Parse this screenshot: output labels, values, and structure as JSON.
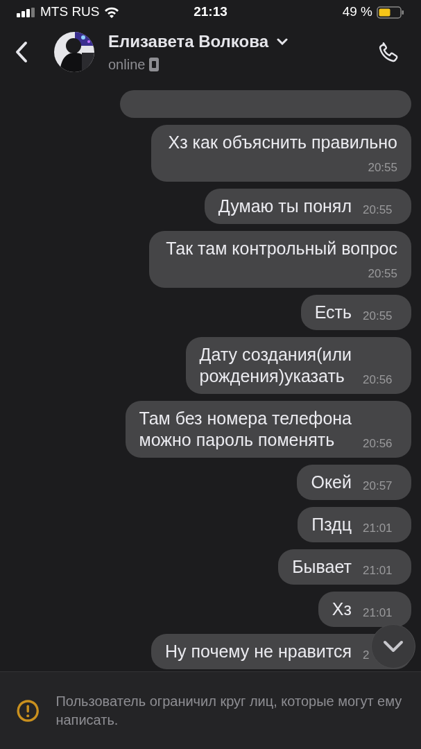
{
  "status_bar": {
    "carrier": "MTS RUS",
    "time": "21:13",
    "battery": "49 %"
  },
  "header": {
    "name": "Елизавета Волкова",
    "status": "online"
  },
  "messages": [
    {
      "text": "Хз как объяснить правильно",
      "time": "20:55",
      "kind": "stacked"
    },
    {
      "text": "Думаю ты понял",
      "time": "20:55",
      "kind": "inline"
    },
    {
      "text": "Так там контрольный вопрос",
      "time": "20:55",
      "kind": "stacked"
    },
    {
      "text": "Есть",
      "time": "20:55",
      "kind": "inline"
    },
    {
      "text": "Дату создания(или\nрождения)указать",
      "time": "20:56",
      "kind": "inline"
    },
    {
      "text": "Там без номера телефона\nможно пароль поменять",
      "time": "20:56",
      "kind": "inline"
    },
    {
      "text": "Окей",
      "time": "20:57",
      "kind": "inline"
    },
    {
      "text": "Пздц",
      "time": "21:01",
      "kind": "inline"
    },
    {
      "text": "Бывает",
      "time": "21:01",
      "kind": "inline"
    },
    {
      "text": "Хз",
      "time": "21:01",
      "kind": "inline"
    },
    {
      "text": "Ну почему не нравится",
      "time": "2",
      "kind": "inline"
    }
  ],
  "notice": {
    "text": "Пользователь ограничил круг лиц, которые могут ему написать."
  }
}
